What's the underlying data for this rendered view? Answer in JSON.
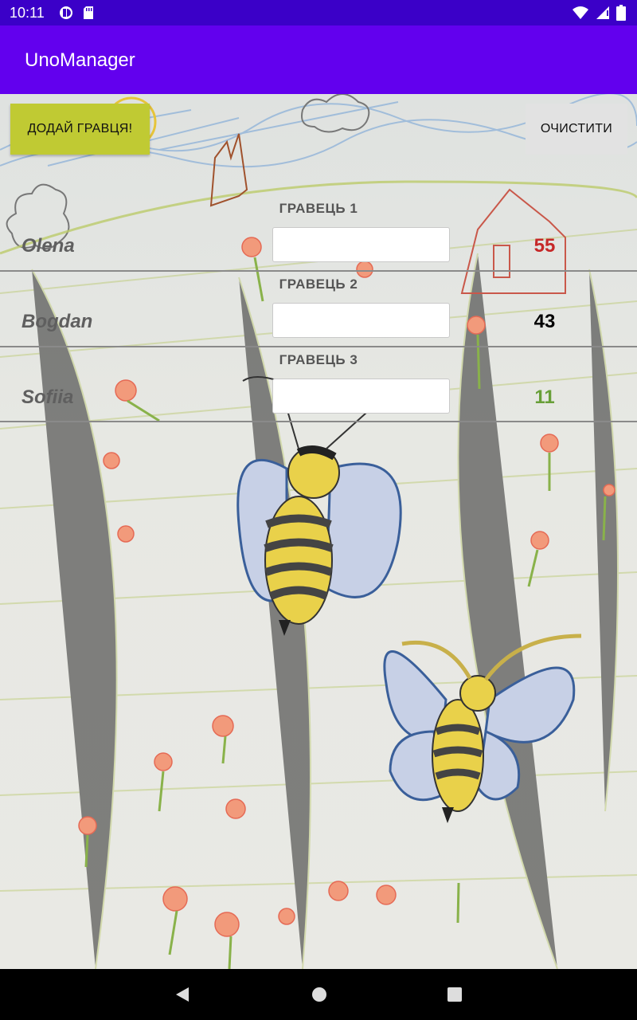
{
  "status_bar": {
    "time": "10:11",
    "left_icons": [
      "cast-icon",
      "sd-card-icon"
    ],
    "right_icons": [
      "wifi-icon",
      "signal-icon",
      "battery-icon"
    ]
  },
  "app_bar": {
    "title": "UnoManager"
  },
  "actions": {
    "add_player_label": "ДОДАЙ ГРАВЦЯ!",
    "clear_label": "ОЧИСТИТИ"
  },
  "players": [
    {
      "header": "ГРАВЕЦЬ 1",
      "name": "Olena",
      "input_value": "",
      "score": "55",
      "score_color": "#c62828"
    },
    {
      "header": "ГРАВЕЦЬ 2",
      "name": "Bogdan",
      "input_value": "",
      "score": "43",
      "score_color": "#000000"
    },
    {
      "header": "ГРАВЕЦЬ 3",
      "name": "Sofiia",
      "input_value": "",
      "score": "11",
      "score_color": "#689f38"
    }
  ],
  "colors": {
    "status_bar": "#3b00c8",
    "app_bar": "#6200ee",
    "add_button": "#c0ca33",
    "clear_button": "#e2e2e2"
  },
  "navigation": [
    "back-icon",
    "home-icon",
    "recents-icon"
  ]
}
